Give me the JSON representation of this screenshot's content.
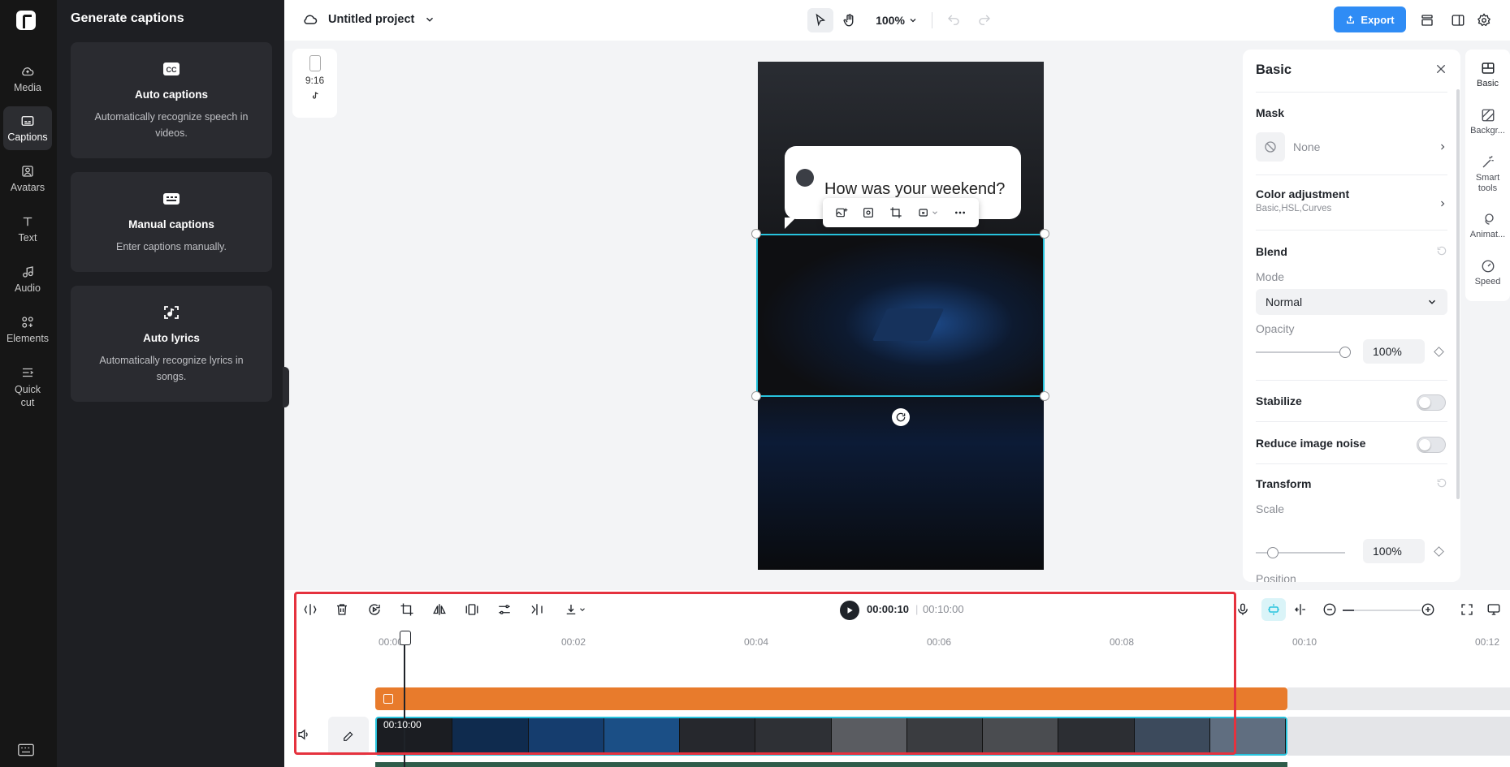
{
  "rail": {
    "items": [
      {
        "label": "Media",
        "icon": "cloud-icon"
      },
      {
        "label": "Captions",
        "icon": "captions-icon",
        "active": true
      },
      {
        "label": "Avatars",
        "icon": "avatar-icon"
      },
      {
        "label": "Text",
        "icon": "text-icon"
      },
      {
        "label": "Audio",
        "icon": "music-note-icon"
      },
      {
        "label": "Elements",
        "icon": "elements-icon"
      },
      {
        "label_line1": "Quick",
        "label_line2": "cut",
        "icon": "quick-cut-icon"
      }
    ]
  },
  "captions_panel": {
    "title": "Generate captions",
    "cards": [
      {
        "title": "Auto captions",
        "desc": "Automatically recognize speech in videos.",
        "icon": "cc-icon"
      },
      {
        "title": "Manual captions",
        "desc": "Enter captions manually.",
        "icon": "keyboard-icon"
      },
      {
        "title": "Auto lyrics",
        "desc": "Automatically recognize lyrics in songs.",
        "icon": "lyrics-icon"
      }
    ]
  },
  "topbar": {
    "project_name": "Untitled project",
    "zoom": "100%",
    "export_label": "Export"
  },
  "canvas": {
    "ratio": "9:16",
    "speech_text": "How was your weekend?"
  },
  "properties": {
    "title": "Basic",
    "mask_label": "Mask",
    "mask_value": "None",
    "color_adjustment": "Color adjustment",
    "color_adjustment_sub": "Basic,HSL,Curves",
    "blend": "Blend",
    "mode_label": "Mode",
    "mode_value": "Normal",
    "opacity_label": "Opacity",
    "opacity_value": "100%",
    "opacity_fraction": 1.0,
    "stabilize": "Stabilize",
    "reduce_noise": "Reduce image noise",
    "transform": "Transform",
    "scale_label": "Scale",
    "scale_value": "100%",
    "position_label": "Position"
  },
  "side_tabs": [
    {
      "label": "Basic",
      "icon": "basic-icon"
    },
    {
      "label": "Backgr...",
      "icon": "background-icon"
    },
    {
      "label_line1": "Smart",
      "label_line2": "tools",
      "icon": "magic-wand-icon"
    },
    {
      "label": "Animat...",
      "icon": "animation-icon"
    },
    {
      "label": "Speed",
      "icon": "speed-icon"
    }
  ],
  "timeline": {
    "current_time": "00:00:10",
    "separator": "|",
    "total_time": "00:10:00",
    "ruler": [
      "00:00",
      "00:02",
      "00:04",
      "00:06",
      "00:08",
      "00:10",
      "00:12"
    ],
    "clip_duration": "00:10:00"
  },
  "colors": {
    "accent": "#2f8cf5",
    "selection": "#27c3dd",
    "text_track": "#e87b2c",
    "highlight": "#e5323e"
  }
}
